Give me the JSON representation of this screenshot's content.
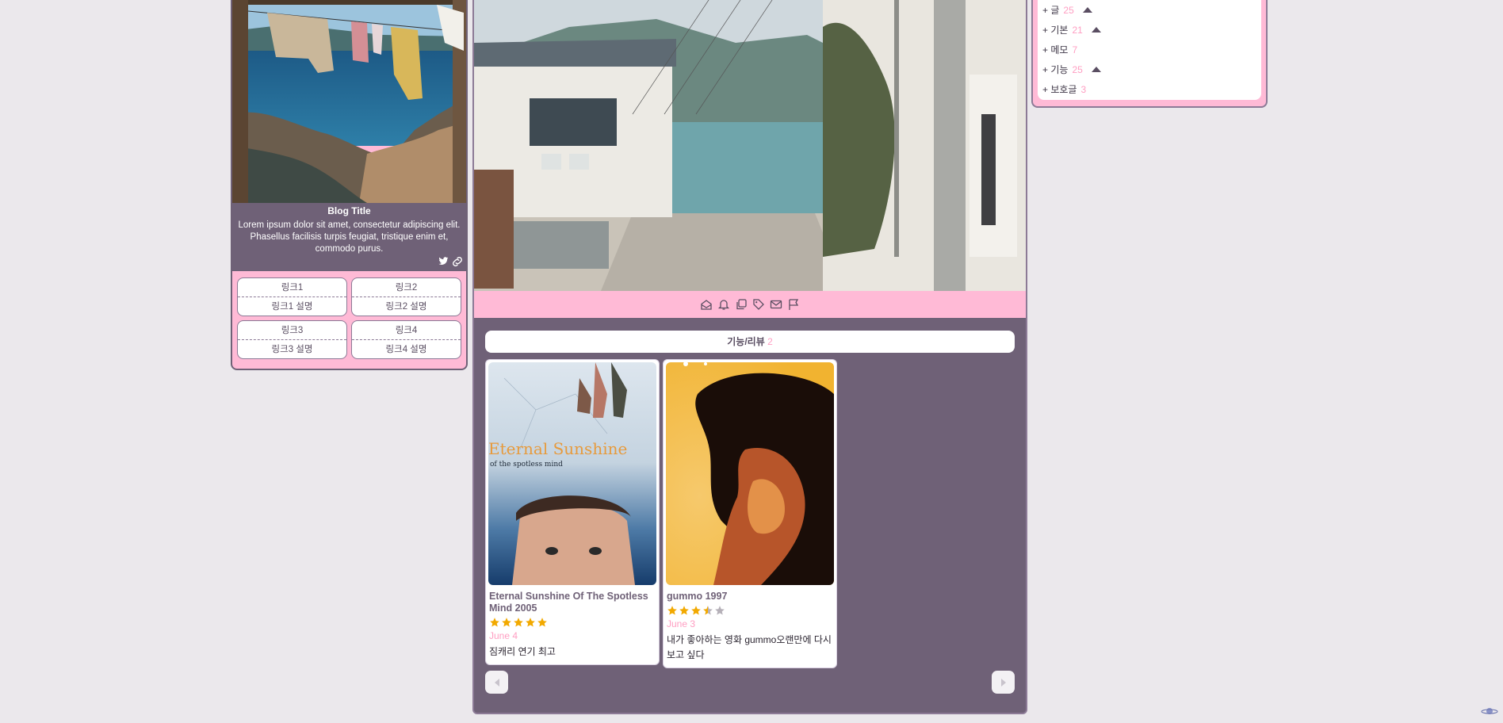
{
  "profile": {
    "blog_title": "Blog Title",
    "description": "Lorem ipsum dolor sit amet, consectetur adipiscing elit. Phasellus facilisis turpis feugiat, tristique enim et, commodo purus.",
    "social_icons": [
      "twitter-icon",
      "link-icon"
    ],
    "links": [
      {
        "name": "링크1",
        "desc": "링크1 설명"
      },
      {
        "name": "링크2",
        "desc": "링크2 설명"
      },
      {
        "name": "링크3",
        "desc": "링크3 설명"
      },
      {
        "name": "링크4",
        "desc": "링크4 설명"
      }
    ]
  },
  "toolbar_icons": [
    "home-icon",
    "bell-icon",
    "copy-icon",
    "tag-icon",
    "mail-icon",
    "flag-icon"
  ],
  "category_header": {
    "label": "기능/리뷰",
    "count": "2"
  },
  "reviews": [
    {
      "title": "Eternal Sunshine Of The Spotless Mind 2005",
      "poster_text": "Eternal Sunshine",
      "poster_subtext": "of the spotless mind",
      "rating": 5,
      "date": "June 4",
      "review": "짐캐리 연기 최고"
    },
    {
      "title": "gummo 1997",
      "rating": 3.5,
      "date": "June 3",
      "review": "내가 좋아하는 영화 gummo오랜만에 다시 보고 싶다"
    }
  ],
  "categories": [
    {
      "label": "+ 글",
      "count": "25",
      "expanded": true
    },
    {
      "label": "+ 기본",
      "count": "21",
      "expanded": true
    },
    {
      "label": "+ 메모",
      "count": "7",
      "expanded": false
    },
    {
      "label": "+ 기능",
      "count": "25",
      "expanded": true
    },
    {
      "label": "+ 보호글",
      "count": "3",
      "expanded": false
    }
  ],
  "colors": {
    "accent_pink": "#ffbad6",
    "panel_purple": "#6f6177",
    "count_pink": "#ff9ec2",
    "star": "#f2a900"
  }
}
